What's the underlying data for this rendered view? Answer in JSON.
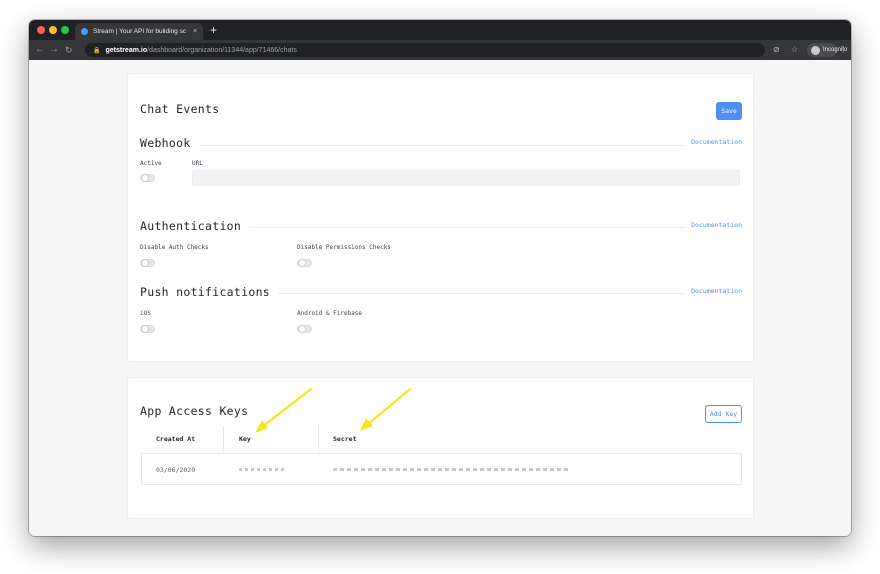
{
  "browser": {
    "tab_title": "Stream | Your API for building sc",
    "tab_close": "×",
    "new_tab": "+",
    "url_host": "getstream.io",
    "url_path": "/dashboard/organization/11344/app/71466/chats",
    "incognito_label": "Incognito"
  },
  "chat_events": {
    "title": "Chat Events",
    "save_label": "Save",
    "webhook": {
      "heading": "Webhook",
      "doc_link": "Documentation",
      "active_label": "Active",
      "url_label": "URL",
      "url_value": ""
    },
    "authentication": {
      "heading": "Authentication",
      "doc_link": "Documentation",
      "disable_auth_label": "Disable Auth Checks",
      "disable_permissions_label": "Disable Permissions Checks"
    },
    "push": {
      "heading": "Push notifications",
      "doc_link": "Documentation",
      "ios_label": "iOS",
      "android_label": "Android & Firebase"
    }
  },
  "access_keys": {
    "title": "App Access Keys",
    "add_key_label": "Add Key",
    "columns": [
      "Created At",
      "Key",
      "Secret"
    ],
    "rows": [
      {
        "created_at": "03/06/2020"
      }
    ]
  },
  "colors": {
    "accent": "#4d8ff5",
    "annotation_arrow": "#f5e61b"
  }
}
